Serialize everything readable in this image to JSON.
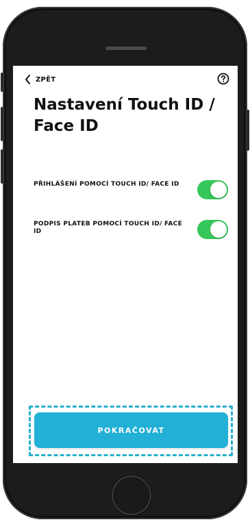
{
  "nav": {
    "back_label": "ZPĚT",
    "back_icon": "chevron-left-icon",
    "help_icon": "question-circle-icon"
  },
  "page": {
    "title": "Nastavení Touch ID / Face ID"
  },
  "settings": [
    {
      "label": "PŘIHLÁŠENÍ POMOCÍ TOUCH ID/ FACE ID",
      "enabled": true
    },
    {
      "label": "PODPIS PLATEB POMOCÍ TOUCH ID/ FACE ID",
      "enabled": true
    }
  ],
  "footer": {
    "continue_label": "POKRAČOVAT"
  },
  "colors": {
    "accent": "#22b0d6",
    "toggle_on": "#35c759",
    "highlight_outline": "#27aecd"
  }
}
